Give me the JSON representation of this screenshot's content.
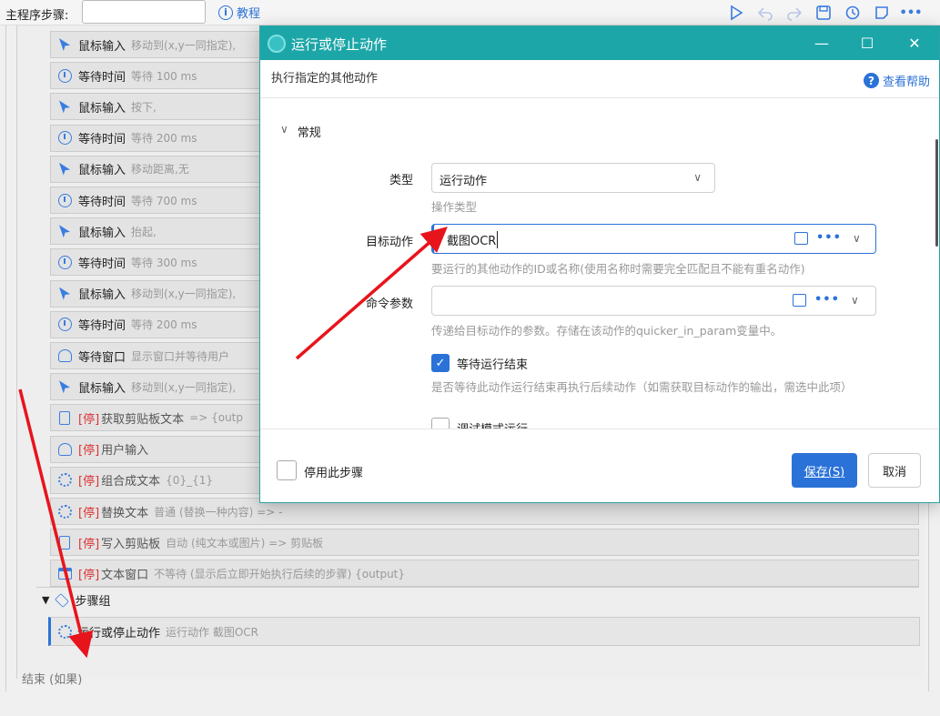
{
  "toolbar": {
    "main_steps_label": "主程序步骤:",
    "search_value": "",
    "tutorial_label": "教程",
    "icons": [
      "play-icon",
      "undo-icon",
      "redo-icon",
      "save-icon",
      "history-icon",
      "note-icon",
      "more-icon"
    ]
  },
  "steps": [
    {
      "icon": "cursor-icon",
      "title": "鼠标输入",
      "desc": "移动到(x,y一同指定),",
      "stopped": ""
    },
    {
      "icon": "clock-icon",
      "title": "等待时间",
      "desc": "等待 100 ms",
      "stopped": ""
    },
    {
      "icon": "cursor-icon",
      "title": "鼠标输入",
      "desc": "按下,",
      "stopped": ""
    },
    {
      "icon": "clock-icon",
      "title": "等待时间",
      "desc": "等待 200 ms",
      "stopped": ""
    },
    {
      "icon": "cursor-icon",
      "title": "鼠标输入",
      "desc": "移动距离,无",
      "stopped": ""
    },
    {
      "icon": "clock-icon",
      "title": "等待时间",
      "desc": "等待 700 ms",
      "stopped": ""
    },
    {
      "icon": "cursor-icon",
      "title": "鼠标输入",
      "desc": "抬起,",
      "stopped": ""
    },
    {
      "icon": "clock-icon",
      "title": "等待时间",
      "desc": "等待 300 ms",
      "stopped": ""
    },
    {
      "icon": "cursor-icon",
      "title": "鼠标输入",
      "desc": "移动到(x,y一同指定),",
      "stopped": ""
    },
    {
      "icon": "clock-icon",
      "title": "等待时间",
      "desc": "等待 200 ms",
      "stopped": ""
    },
    {
      "icon": "user-icon",
      "title": "等待窗口",
      "desc": "显示窗口并等待用户",
      "stopped": ""
    },
    {
      "icon": "cursor-icon",
      "title": "鼠标输入",
      "desc": "移动到(x,y一同指定),",
      "stopped": ""
    },
    {
      "icon": "doc-icon",
      "title": "获取剪贴板文本",
      "desc": "=> {outp",
      "stopped": "[停]"
    },
    {
      "icon": "user-icon",
      "title": "用户输入",
      "desc": "",
      "stopped": "[停]"
    },
    {
      "icon": "gear-icon",
      "title": "组合成文本",
      "desc": "{0}_{1}",
      "stopped": "[停]"
    },
    {
      "icon": "gear-icon",
      "title": "替换文本",
      "desc": "普通 (替换一种内容) => -",
      "stopped": "[停]"
    },
    {
      "icon": "doc-icon",
      "title": "写入剪贴板",
      "desc": "自动 (纯文本或图片) => 剪贴板",
      "stopped": "[停]"
    },
    {
      "icon": "window-icon",
      "title": "文本窗口",
      "desc": "不等待 (显示后立即开始执行后续的步骤) {output}",
      "stopped": "[停]"
    }
  ],
  "group": {
    "label": "步骤组",
    "child_title": "运行或停止动作",
    "child_desc": "运行动作 截图OCR"
  },
  "end_label": "结束 (如果)",
  "dialog": {
    "title": "运行或停止动作",
    "description": "执行指定的其他动作",
    "help_label": "查看帮助",
    "section_label": "常规",
    "type_label": "类型",
    "type_value": "运行动作",
    "type_hint": "操作类型",
    "target_label": "目标动作",
    "target_value": "截图OCR",
    "target_hint": "要运行的其他动作的ID或名称(使用名称时需要完全匹配且不能有重名动作)",
    "param_label": "命令参数",
    "param_value": "",
    "param_hint": "传递给目标动作的参数。存储在该动作的quicker_in_param变量中。",
    "wait_label": "等待运行结束",
    "wait_hint": "是否等待此动作运行结束再执行后续动作（如需获取目标动作的输出，需选中此项）",
    "debug_label": "调试模式运行",
    "disable_label": "停用此步骤",
    "save_label": "保存(S)",
    "cancel_label": "取消",
    "minimize_glyph": "—",
    "maximize_glyph": "☐",
    "close_glyph": "✕",
    "more_glyph": "•••",
    "chevron_glyph": "∨"
  },
  "colors": {
    "accent": "#2b72d8",
    "titlebar": "#1da6a8",
    "stopped": "#d33333",
    "annotation_arrow": "#e8141c"
  }
}
